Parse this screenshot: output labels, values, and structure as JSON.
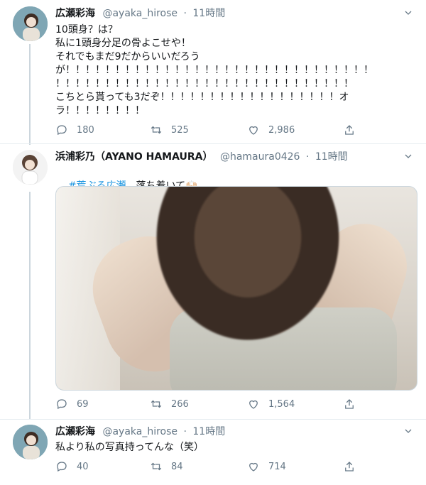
{
  "tweets": [
    {
      "name": "広瀬彩海",
      "handle": "@ayaka_hirose",
      "dot": "·",
      "time": "11時間",
      "text": "10頭身？は？\n私に1頭身分足の骨よこせや！\nそれでもまだ9だからいいだろう\nが！！！！！！！！！！！！！！！！！！！！！！！！！！！！！！！\n！！！！！！！！！！！！！！！！！！！！！！！！！！！！！！\nこちとら貰っても3だぞ！！！！！！！！！！！！！！！！！！オ\nラ！！！！！！！！",
      "replies": "180",
      "retweets": "525",
      "likes": "2,986"
    },
    {
      "name": "浜浦彩乃（AYANO HAMAURA）",
      "handle": "@hamaura0426",
      "dot": "·",
      "time": "11時間",
      "hashtag": "#荒ぶる広瀬",
      "text_after": "　落ち着いて🙌🏻",
      "replies": "69",
      "retweets": "266",
      "likes": "1,564"
    },
    {
      "name": "広瀬彩海",
      "handle": "@ayaka_hirose",
      "dot": "·",
      "time": "11時間",
      "text": "私より私の写真持ってんな（笑）",
      "replies": "40",
      "retweets": "84",
      "likes": "714"
    }
  ],
  "icons": {
    "reply": "reply-icon",
    "retweet": "retweet-icon",
    "like": "heart-icon",
    "share": "share-icon",
    "menu": "chevron-down-icon"
  },
  "colors": {
    "text": "#14171a",
    "secondary": "#657786",
    "link": "#1b95e0",
    "border": "#e6ecf0"
  }
}
